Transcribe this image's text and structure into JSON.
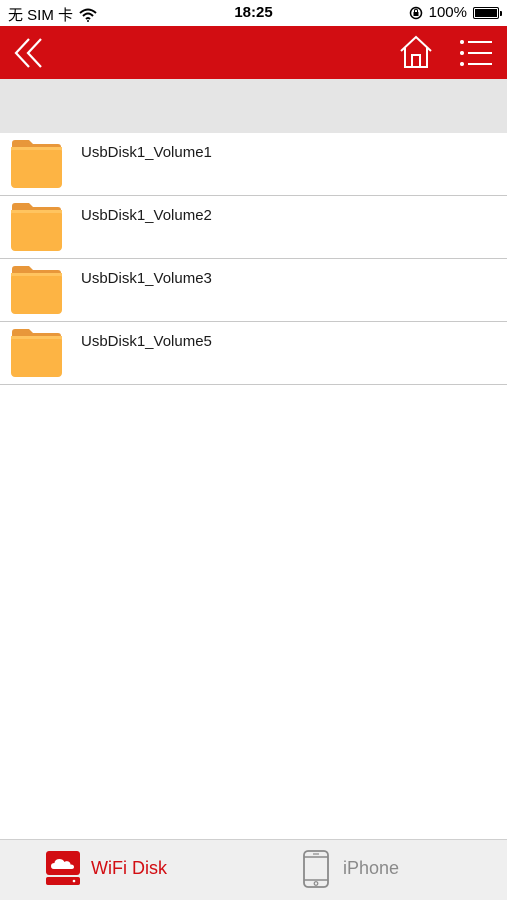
{
  "status_bar": {
    "carrier": "无 SIM 卡",
    "time": "18:25",
    "battery_percent": "100%",
    "battery_level": 1.0,
    "icons": [
      "wifi-icon",
      "orientation-lock-icon",
      "battery-icon"
    ]
  },
  "nav_bar": {
    "color": "#d20d12",
    "icons": [
      "double-chevron-left-icon",
      "home-icon",
      "list-menu-icon"
    ]
  },
  "files": [
    {
      "name": "UsbDisk1_Volume1",
      "icon": "folder-icon"
    },
    {
      "name": "UsbDisk1_Volume2",
      "icon": "folder-icon"
    },
    {
      "name": "UsbDisk1_Volume3",
      "icon": "folder-icon"
    },
    {
      "name": "UsbDisk1_Volume5",
      "icon": "folder-icon"
    }
  ],
  "tab_bar": {
    "tabs": [
      {
        "label": "WiFi Disk",
        "icon": "cloud-disk-icon",
        "active": true,
        "color": "#d20d12"
      },
      {
        "label": "iPhone",
        "icon": "iphone-icon",
        "active": false,
        "color": "#8a8a8a"
      }
    ]
  },
  "colors": {
    "accent": "#d20d12",
    "folder": "#fdb444",
    "band": "#e5e5e5"
  }
}
